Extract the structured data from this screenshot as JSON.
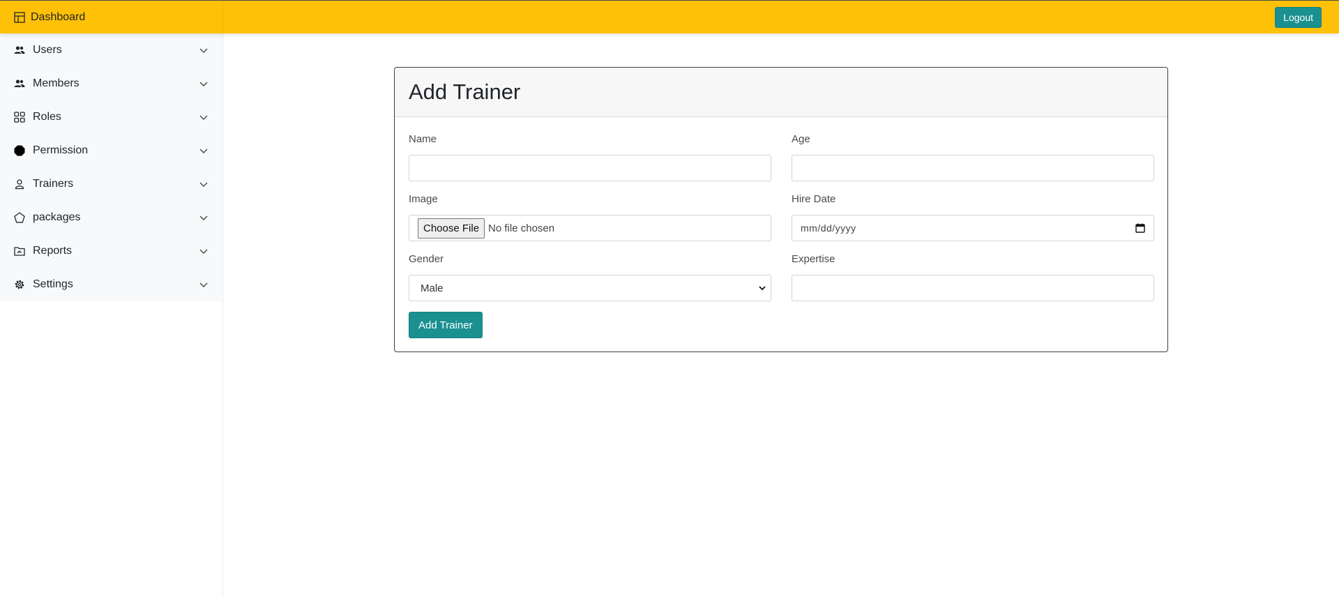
{
  "topbar": {
    "brand_label": "Dashboard",
    "brand_icon": "table-icon",
    "logout_label": "Logout",
    "background_color": "#ffc107",
    "logout_color": "#1a9090"
  },
  "sidebar": {
    "items": [
      {
        "label": "Users",
        "icon": "people-icon"
      },
      {
        "label": "Members",
        "icon": "people-icon"
      },
      {
        "label": "Roles",
        "icon": "grid-icon"
      },
      {
        "label": "Permission",
        "icon": "octagon-icon"
      },
      {
        "label": "Trainers",
        "icon": "person-icon"
      },
      {
        "label": "packages",
        "icon": "pentagon-icon"
      },
      {
        "label": "Reports",
        "icon": "folder-icon"
      },
      {
        "label": "Settings",
        "icon": "gear-icon"
      }
    ]
  },
  "form": {
    "title": "Add Trainer",
    "name": {
      "label": "Name",
      "value": ""
    },
    "age": {
      "label": "Age",
      "value": ""
    },
    "image": {
      "label": "Image",
      "button_label": "Choose File",
      "status": "No file chosen"
    },
    "hire_date": {
      "label": "Hire Date",
      "placeholder": "mm/dd/yyyy"
    },
    "gender": {
      "label": "Gender",
      "selected": "Male"
    },
    "expertise": {
      "label": "Expertise",
      "value": ""
    },
    "submit_label": "Add Trainer"
  }
}
